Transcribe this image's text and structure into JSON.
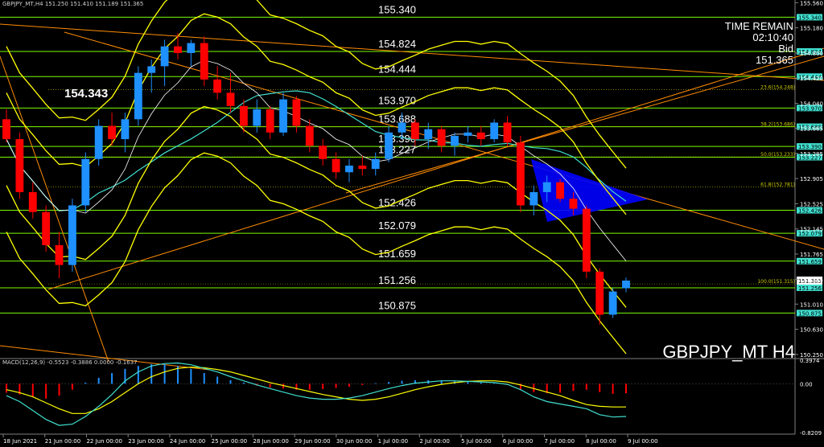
{
  "header": "GBPJPY_MT,H4  151.250 151.410 151.189 151.365",
  "info": {
    "time_remain_label": "TIME REMAIN",
    "time_remain": "02:10:40",
    "bid_label": "Bid",
    "bid": "151.365"
  },
  "symbol_label": "GBPJPY_MT H4",
  "peak_label": "154.343",
  "macd_header": "MACD(12,26,9) -0.5523 -0.3886 0.0000 -0.1637",
  "colors": {
    "background": "#000000",
    "up": "#1e90ff",
    "down": "#ff0000",
    "level": "#7cfc00",
    "band": "#ffff00",
    "trend": "#ff8c00",
    "ma": "#40e0d0",
    "triangle": "#0000ff",
    "macd_signal": "#ffff00",
    "macd_main": "#40e0d0"
  },
  "chart_data": {
    "type": "candlestick",
    "symbol": "GBPJPY_MT",
    "timeframe": "H4",
    "ylim": [
      150.2,
      155.6
    ],
    "yticks": [
      "155.560",
      "155.180",
      "154.800",
      "154.420",
      "154.040",
      "153.665",
      "153.285",
      "152.905",
      "152.525",
      "152.145",
      "151.765",
      "151.385",
      "151.010",
      "150.630",
      "150.250"
    ],
    "date_labels": [
      "18 Jun 2021",
      "21 Jun 00:00",
      "22 Jun 00:00",
      "23 Jun 00:00",
      "24 Jun 00:00",
      "25 Jun 00:00",
      "28 Jun 00:00",
      "29 Jun 00:00",
      "30 Jun 00:00",
      "1 Jul 00:00",
      "2 Jul 00:00",
      "5 Jul 00:00",
      "6 Jul 00:00",
      "7 Jul 00:00",
      "8 Jul 00:00",
      "9 Jul 00:00"
    ],
    "levels": [
      {
        "value": 155.34,
        "label": "155.340"
      },
      {
        "value": 154.824,
        "label": "154.824"
      },
      {
        "value": 154.444,
        "label": "154.444"
      },
      {
        "value": 153.97,
        "label": "153.970"
      },
      {
        "value": 153.688,
        "label": "153.688"
      },
      {
        "value": 153.39,
        "label": "153.390"
      },
      {
        "value": 153.227,
        "label": "153.227"
      },
      {
        "value": 152.426,
        "label": "152.426"
      },
      {
        "value": 152.079,
        "label": "152.079"
      },
      {
        "value": 151.659,
        "label": "151.659"
      },
      {
        "value": 151.256,
        "label": "151.256"
      },
      {
        "value": 150.875,
        "label": "150.875"
      }
    ],
    "fib_levels": [
      {
        "value": 154.248,
        "label": "23.6(154.248)"
      },
      {
        "value": 153.686,
        "label": "38.2(153.686)"
      },
      {
        "value": 153.233,
        "label": "50.0(153.233)"
      },
      {
        "value": 152.781,
        "label": "61.8(152.781)"
      },
      {
        "value": 151.315,
        "label": "100.0(151.315)"
      }
    ],
    "current_price": 151.365,
    "candles": [
      {
        "o": 153.8,
        "h": 153.95,
        "l": 153.45,
        "c": 153.5
      },
      {
        "o": 153.5,
        "h": 153.6,
        "l": 152.6,
        "c": 152.7
      },
      {
        "o": 152.7,
        "h": 152.85,
        "l": 152.3,
        "c": 152.4
      },
      {
        "o": 152.4,
        "h": 152.5,
        "l": 151.8,
        "c": 151.9
      },
      {
        "o": 151.9,
        "h": 152.1,
        "l": 151.4,
        "c": 151.6
      },
      {
        "o": 151.6,
        "h": 152.6,
        "l": 151.5,
        "c": 152.5
      },
      {
        "o": 152.5,
        "h": 153.3,
        "l": 152.4,
        "c": 153.2
      },
      {
        "o": 153.2,
        "h": 153.8,
        "l": 153.1,
        "c": 153.7
      },
      {
        "o": 153.7,
        "h": 153.9,
        "l": 153.4,
        "c": 153.5
      },
      {
        "o": 153.5,
        "h": 153.9,
        "l": 153.3,
        "c": 153.8
      },
      {
        "o": 153.8,
        "h": 154.6,
        "l": 153.7,
        "c": 154.5
      },
      {
        "o": 154.5,
        "h": 154.7,
        "l": 154.2,
        "c": 154.6
      },
      {
        "o": 154.6,
        "h": 155.0,
        "l": 154.3,
        "c": 154.9
      },
      {
        "o": 154.9,
        "h": 155.1,
        "l": 154.7,
        "c": 154.8
      },
      {
        "o": 154.8,
        "h": 155.0,
        "l": 154.6,
        "c": 154.95
      },
      {
        "o": 154.95,
        "h": 155.05,
        "l": 154.3,
        "c": 154.4
      },
      {
        "o": 154.4,
        "h": 154.6,
        "l": 154.1,
        "c": 154.2
      },
      {
        "o": 154.2,
        "h": 154.5,
        "l": 153.9,
        "c": 154.0
      },
      {
        "o": 154.0,
        "h": 154.1,
        "l": 153.6,
        "c": 153.7
      },
      {
        "o": 153.7,
        "h": 154.1,
        "l": 153.6,
        "c": 153.95
      },
      {
        "o": 153.95,
        "h": 154.0,
        "l": 153.5,
        "c": 153.6
      },
      {
        "o": 153.6,
        "h": 154.2,
        "l": 153.55,
        "c": 154.1
      },
      {
        "o": 154.1,
        "h": 154.15,
        "l": 153.6,
        "c": 153.7
      },
      {
        "o": 153.7,
        "h": 153.8,
        "l": 153.3,
        "c": 153.4
      },
      {
        "o": 153.4,
        "h": 153.5,
        "l": 153.1,
        "c": 153.2
      },
      {
        "o": 153.2,
        "h": 153.3,
        "l": 152.9,
        "c": 153.0
      },
      {
        "o": 153.0,
        "h": 153.2,
        "l": 152.85,
        "c": 153.1
      },
      {
        "o": 153.1,
        "h": 153.25,
        "l": 152.95,
        "c": 153.05
      },
      {
        "o": 153.05,
        "h": 153.3,
        "l": 152.95,
        "c": 153.2
      },
      {
        "o": 153.2,
        "h": 153.7,
        "l": 153.15,
        "c": 153.6
      },
      {
        "o": 153.6,
        "h": 153.9,
        "l": 153.5,
        "c": 153.75
      },
      {
        "o": 153.75,
        "h": 153.8,
        "l": 153.4,
        "c": 153.5
      },
      {
        "o": 153.5,
        "h": 153.75,
        "l": 153.35,
        "c": 153.65
      },
      {
        "o": 153.65,
        "h": 153.7,
        "l": 153.3,
        "c": 153.4
      },
      {
        "o": 153.4,
        "h": 153.6,
        "l": 153.25,
        "c": 153.55
      },
      {
        "o": 153.55,
        "h": 153.7,
        "l": 153.45,
        "c": 153.6
      },
      {
        "o": 153.6,
        "h": 153.7,
        "l": 153.4,
        "c": 153.5
      },
      {
        "o": 153.5,
        "h": 153.8,
        "l": 153.45,
        "c": 153.75
      },
      {
        "o": 153.75,
        "h": 153.85,
        "l": 153.4,
        "c": 153.45
      },
      {
        "o": 153.45,
        "h": 153.55,
        "l": 152.4,
        "c": 152.5
      },
      {
        "o": 152.5,
        "h": 152.8,
        "l": 152.35,
        "c": 152.7
      },
      {
        "o": 152.7,
        "h": 152.95,
        "l": 152.55,
        "c": 152.85
      },
      {
        "o": 152.85,
        "h": 152.9,
        "l": 152.55,
        "c": 152.6
      },
      {
        "o": 152.6,
        "h": 152.7,
        "l": 152.35,
        "c": 152.45
      },
      {
        "o": 152.45,
        "h": 152.5,
        "l": 151.4,
        "c": 151.5
      },
      {
        "o": 151.5,
        "h": 151.55,
        "l": 150.7,
        "c": 150.85
      },
      {
        "o": 150.85,
        "h": 151.25,
        "l": 150.8,
        "c": 151.2
      },
      {
        "o": 151.25,
        "h": 151.41,
        "l": 151.189,
        "c": 151.365
      }
    ],
    "macd": {
      "ylim": [
        -0.8209,
        0.3974
      ],
      "yticks": [
        "0.3974",
        "0.00",
        "-0.8209"
      ],
      "histogram": [
        -0.15,
        -0.18,
        -0.22,
        -0.25,
        -0.2,
        -0.1,
        0.02,
        0.1,
        0.18,
        0.25,
        0.3,
        0.33,
        0.33,
        0.3,
        0.25,
        0.18,
        0.12,
        0.06,
        0.02,
        -0.03,
        -0.06,
        -0.08,
        -0.1,
        -0.1,
        -0.09,
        -0.07,
        -0.05,
        -0.02,
        0.01,
        0.03,
        0.05,
        0.06,
        0.06,
        0.05,
        0.04,
        0.03,
        0.02,
        0.01,
        -0.02,
        -0.1,
        -0.14,
        -0.16,
        -0.15,
        -0.12,
        -0.1,
        -0.14,
        -0.17,
        -0.16
      ],
      "signal": [
        -0.1,
        -0.15,
        -0.22,
        -0.32,
        -0.42,
        -0.5,
        -0.5,
        -0.42,
        -0.3,
        -0.15,
        0.0,
        0.12,
        0.2,
        0.26,
        0.28,
        0.27,
        0.24,
        0.2,
        0.14,
        0.08,
        0.02,
        -0.03,
        -0.08,
        -0.13,
        -0.18,
        -0.22,
        -0.26,
        -0.28,
        -0.26,
        -0.22,
        -0.16,
        -0.1,
        -0.05,
        -0.01,
        0.02,
        0.04,
        0.05,
        0.05,
        0.03,
        -0.02,
        -0.08,
        -0.14,
        -0.2,
        -0.28,
        -0.35,
        -0.38,
        -0.39,
        -0.39
      ],
      "main": [
        -0.2,
        -0.3,
        -0.45,
        -0.6,
        -0.7,
        -0.68,
        -0.55,
        -0.38,
        -0.18,
        0.05,
        0.2,
        0.3,
        0.34,
        0.35,
        0.32,
        0.26,
        0.2,
        0.12,
        0.05,
        -0.02,
        -0.08,
        -0.14,
        -0.2,
        -0.24,
        -0.26,
        -0.26,
        -0.24,
        -0.2,
        -0.14,
        -0.08,
        -0.03,
        0.01,
        0.03,
        0.05,
        0.05,
        0.04,
        0.03,
        0.02,
        -0.01,
        -0.1,
        -0.22,
        -0.3,
        -0.34,
        -0.38,
        -0.42,
        -0.52,
        -0.56,
        -0.55
      ]
    }
  }
}
